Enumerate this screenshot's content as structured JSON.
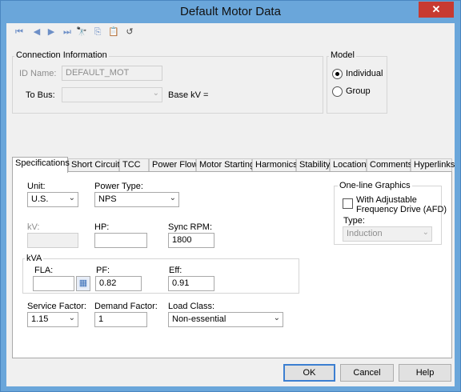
{
  "window": {
    "title": "Default Motor Data",
    "close_glyph": "✕"
  },
  "toolbar": {
    "icons": [
      {
        "name": "first-record-icon",
        "glyph": "⏮"
      },
      {
        "name": "previous-record-icon",
        "glyph": "◀"
      },
      {
        "name": "next-record-icon",
        "glyph": "▶"
      },
      {
        "name": "last-record-icon",
        "glyph": "⏭"
      },
      {
        "name": "find-icon",
        "glyph": "🔭"
      },
      {
        "name": "copy-icon",
        "glyph": "⎘"
      },
      {
        "name": "paste-icon",
        "glyph": "📋"
      },
      {
        "name": "undo-icon",
        "glyph": "↺"
      }
    ]
  },
  "connection": {
    "title": "Connection Information",
    "id_label": "ID Name:",
    "id_value": "DEFAULT_MOT",
    "to_bus_label": "To Bus:",
    "to_bus_value": "",
    "base_kv_label": "Base kV ="
  },
  "model": {
    "title": "Model",
    "options": [
      "Individual",
      "Group"
    ],
    "selected": "Individual"
  },
  "tabs": [
    "Specifications",
    "Short Circuit",
    "TCC",
    "Power Flow",
    "Motor Starting",
    "Harmonics",
    "Stability",
    "Location",
    "Comments",
    "Hyperlinks"
  ],
  "active_tab": "Specifications",
  "specs": {
    "unit_label": "Unit:",
    "unit_value": "U.S.",
    "power_type_label": "Power Type:",
    "power_type_value": "NPS",
    "kv_label": "kV:",
    "kv_value": "",
    "hp_label": "HP:",
    "hp_value": "",
    "sync_rpm_label": "Sync RPM:",
    "sync_rpm_value": "1800",
    "kva_label": "kVA",
    "fla_label": "FLA:",
    "fla_value": "",
    "pf_label": "PF:",
    "pf_value": "0.82",
    "eff_label": "Eff:",
    "eff_value": "0.91",
    "service_factor_label": "Service Factor:",
    "service_factor_value": "1.15",
    "demand_factor_label": "Demand Factor:",
    "demand_factor_value": "1",
    "load_class_label": "Load Class:",
    "load_class_value": "Non-essential"
  },
  "oneline": {
    "title": "One-line Graphics",
    "afd_label_1": "With Adjustable",
    "afd_label_2": "Frequency Drive (AFD)",
    "afd_checked": false,
    "type_label": "Type:",
    "type_value": "Induction"
  },
  "buttons": {
    "ok": "OK",
    "cancel": "Cancel",
    "help": "Help"
  }
}
